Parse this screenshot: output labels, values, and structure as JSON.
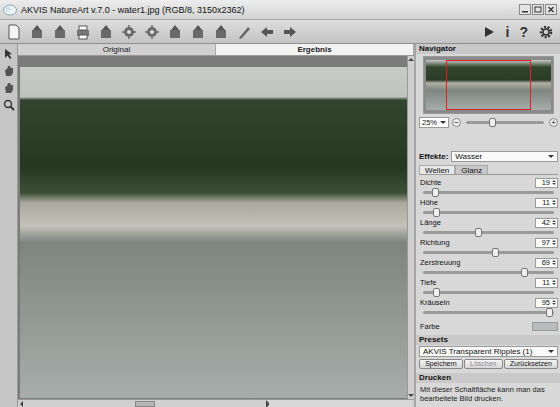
{
  "window": {
    "title": "AKVIS NatureArt v.7.0 - water1.jpg (RGB/8, 3150x2362)"
  },
  "toolbar_right": [
    {
      "kind": "play"
    },
    {
      "kind": "text",
      "label": "i"
    },
    {
      "kind": "text",
      "label": "?"
    },
    {
      "kind": "gear"
    }
  ],
  "view_tabs": [
    {
      "label": "Original",
      "selected": false
    },
    {
      "label": "Ergebnis",
      "selected": true
    }
  ],
  "image_view": {
    "h_scroll_position": 0.5
  },
  "navigator": {
    "title": "Navigator",
    "zoom": "25%",
    "zoom_out": "−",
    "zoom_in": "+",
    "zoom_level": 0.33
  },
  "effects": {
    "label": "Effekte:",
    "value": "Wasser"
  },
  "effect_tabs": [
    {
      "label": "Wellen",
      "selected": true
    },
    {
      "label": "Glanz",
      "selected": false
    }
  ],
  "parameters": [
    {
      "kind": "slider",
      "label": "Dichte",
      "value": "19",
      "level": 0.09
    },
    {
      "kind": "slider",
      "label": "Höhe",
      "value": "11",
      "level": 0.1
    },
    {
      "kind": "slider",
      "label": "Länge",
      "value": "42",
      "level": 0.42
    },
    {
      "kind": "slider",
      "label": "Richtung",
      "value": "97",
      "level": 0.55
    },
    {
      "kind": "slider",
      "label": "Zerstreuung",
      "value": "69",
      "level": 0.77
    },
    {
      "kind": "slider",
      "label": "Tiefe",
      "value": "11",
      "level": 0.1
    },
    {
      "kind": "slider",
      "label": "Kräuseln",
      "value": "95",
      "level": 0.96
    },
    {
      "kind": "color",
      "label": "Farbe",
      "color": "#b7bdbd"
    }
  ],
  "presets": {
    "title": "Presets",
    "selected": "AKVIS Transparent Ripples (1)",
    "buttons": [
      {
        "label": "Speichern",
        "disabled": false
      },
      {
        "label": "Löschen",
        "disabled": true
      },
      {
        "label": "Zurücksetzen",
        "disabled": false
      }
    ]
  },
  "help": {
    "title": "Drucken",
    "text": "Mit dieser Schaltfläche kann man das bearbeitete Bild drucken."
  }
}
